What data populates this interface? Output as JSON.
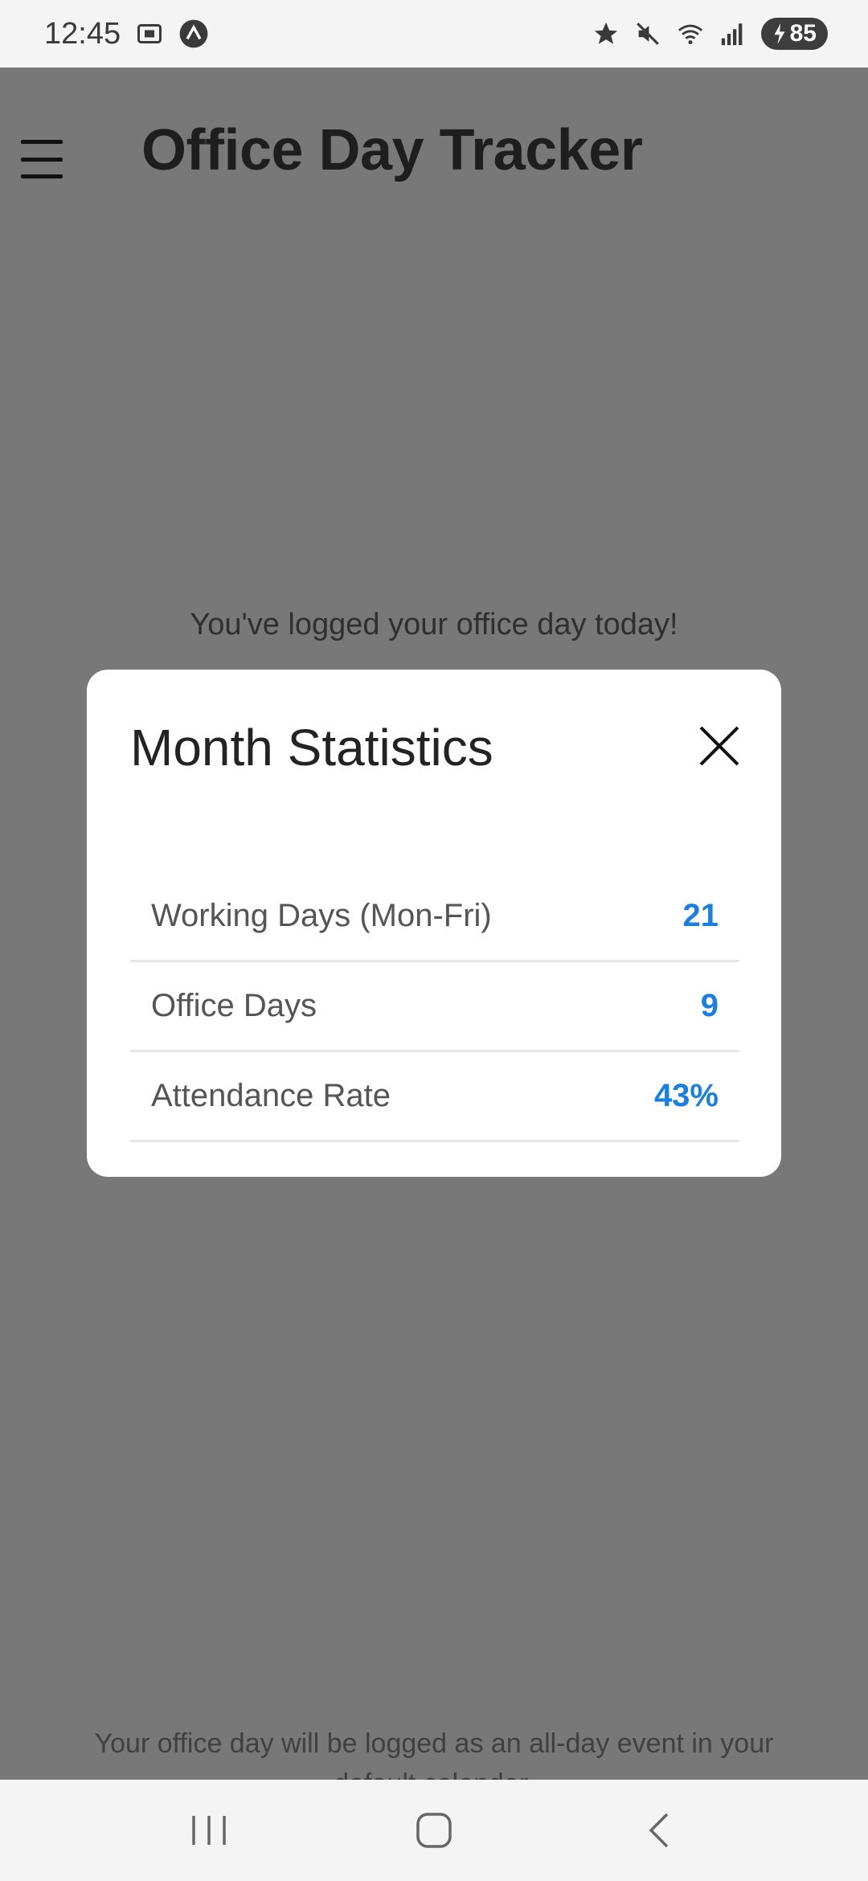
{
  "status_bar": {
    "time": "12:45",
    "battery": "85",
    "icons": [
      "screenshot-icon",
      "app-badge-icon",
      "star-icon",
      "mute-icon",
      "wifi-icon",
      "signal-icon",
      "battery-icon"
    ]
  },
  "app": {
    "title": "Office Day Tracker",
    "logged_message": "You've logged your office day today!",
    "footer_note": "Your office day will be logged as an all-day event in your default calendar."
  },
  "modal": {
    "title": "Month Statistics",
    "stats": [
      {
        "label": "Working Days (Mon-Fri)",
        "value": "21"
      },
      {
        "label": "Office Days",
        "value": "9"
      },
      {
        "label": "Attendance Rate",
        "value": "43%"
      }
    ]
  },
  "colors": {
    "accent": "#1a7fe0",
    "overlay": "#787878",
    "modal_bg": "#ffffff"
  }
}
